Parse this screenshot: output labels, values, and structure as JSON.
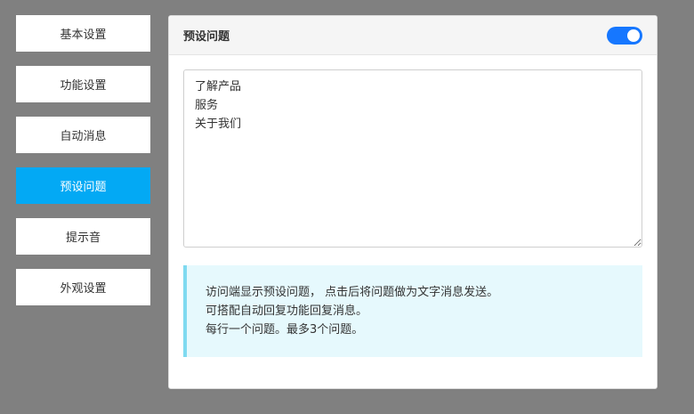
{
  "sidebar": {
    "items": [
      {
        "label": "基本设置",
        "active": false
      },
      {
        "label": "功能设置",
        "active": false
      },
      {
        "label": "自动消息",
        "active": false
      },
      {
        "label": "预设问题",
        "active": true
      },
      {
        "label": "提示音",
        "active": false
      },
      {
        "label": "外观设置",
        "active": false
      }
    ]
  },
  "panel": {
    "title": "预设问题",
    "toggle_on": true,
    "questions_text": "了解产品\n服务\n关于我们",
    "info_lines": [
      "访问端显示预设问题， 点击后将问题做为文字消息发送。",
      "可搭配自动回复功能回复消息。",
      "每行一个问题。最多3个问题。"
    ]
  },
  "colors": {
    "background": "#808080",
    "active_nav": "#03a9f4",
    "toggle": "#1677ff",
    "info_bg": "#e6f9fd",
    "info_border": "#7fdaf0"
  }
}
